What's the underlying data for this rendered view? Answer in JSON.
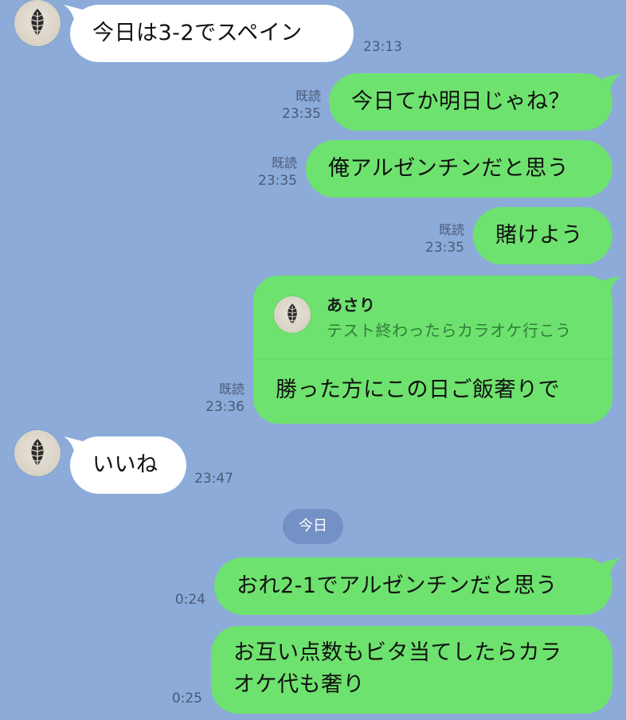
{
  "date_separator": "今日",
  "read_label": "既読",
  "messages": [
    {
      "side": "left",
      "text": "今日は3-2でスペイン",
      "time": "23:13"
    },
    {
      "side": "right",
      "text": "今日てか明日じゃね？",
      "time": "23:35",
      "read": true
    },
    {
      "side": "right",
      "text": "俺アルゼンチンだと思う",
      "time": "23:35",
      "read": true
    },
    {
      "side": "right",
      "text": "賭けよう",
      "time": "23:35",
      "read": true
    },
    {
      "side": "right",
      "text": "勝った方にこの日ご飯奢りで",
      "time": "23:36",
      "read": true,
      "reply_to": {
        "name": "あさり",
        "text": "テスト終わったらカラオケ行こう"
      }
    },
    {
      "side": "left",
      "text": "いいね",
      "time": "23:47"
    },
    {
      "side": "right",
      "text": "おれ2-1でアルゼンチンだと思う",
      "time": "0:24"
    },
    {
      "side": "right",
      "text_line1": "お互い点数もビタ当てしたらカラ",
      "text_line2": "オケ代も奢り",
      "time": "0:25"
    }
  ],
  "colors": {
    "background": "#8cabd9",
    "sent_bubble": "#6ee26e",
    "received_bubble": "#ffffff",
    "date_pill": "#7391c4"
  },
  "icons": {
    "avatar": "leaf-avatar-icon"
  }
}
